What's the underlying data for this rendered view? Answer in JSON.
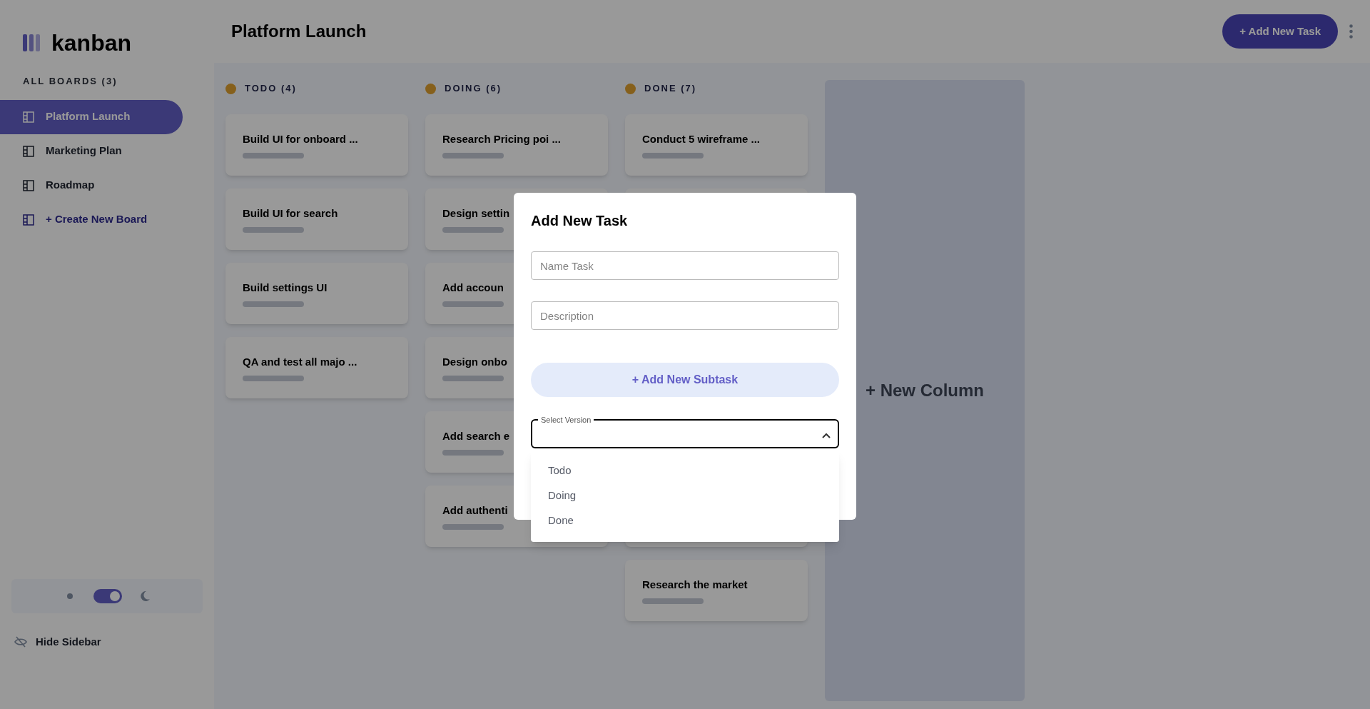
{
  "sidebar": {
    "logo": "kanban",
    "heading": "ALL BOARDS (3)",
    "boards": [
      {
        "label": "Platform Launch",
        "selected": true
      },
      {
        "label": "Marketing Plan",
        "selected": false
      },
      {
        "label": "Roadmap",
        "selected": false
      }
    ],
    "create_board": "+ Create New Board",
    "theme_toggle": {
      "on": true
    },
    "hide_sidebar": "Hide Sidebar"
  },
  "header": {
    "title": "Platform Launch",
    "add_task": "+ Add New Task"
  },
  "columns": [
    {
      "name": "TODO (4)",
      "cards": [
        {
          "kind": "card",
          "title": "Build UI for onboard ..."
        },
        {
          "kind": "card",
          "title": "Build UI for search"
        },
        {
          "kind": "card",
          "title": "Build settings UI"
        },
        {
          "kind": "card",
          "title": "QA and test all majo ..."
        }
      ]
    },
    {
      "name": "DOING (6)",
      "cards": [
        {
          "kind": "card",
          "title": "Research Pricing poi ..."
        },
        {
          "kind": "card",
          "title": "Design settin"
        },
        {
          "kind": "card",
          "title": "Add accoun"
        },
        {
          "kind": "card",
          "title": "Design onbo"
        },
        {
          "kind": "card",
          "title": "Add search e"
        },
        {
          "kind": "card",
          "title": "Add authenti"
        }
      ]
    },
    {
      "name": "DONE (7)",
      "cards": [
        {
          "kind": "card",
          "title": "Conduct 5 wireframe ..."
        },
        {
          "kind": "covered"
        },
        {
          "kind": "covered"
        },
        {
          "kind": "covered"
        },
        {
          "kind": "covered"
        },
        {
          "kind": "covered"
        },
        {
          "kind": "card",
          "title": "Research the market"
        }
      ]
    }
  ],
  "new_column": "+ New Column",
  "modal": {
    "title": "Add New Task",
    "name_field": {
      "placeholder": "Name Task"
    },
    "description_field": {
      "placeholder": "Description"
    },
    "add_subtask": "+ Add New Subtask",
    "select": {
      "label": "Select Version",
      "expanded": true,
      "options": [
        {
          "label": "Todo",
          "selected": false
        },
        {
          "label": "Doing",
          "selected": false
        },
        {
          "label": "Done",
          "selected": false
        }
      ]
    }
  }
}
